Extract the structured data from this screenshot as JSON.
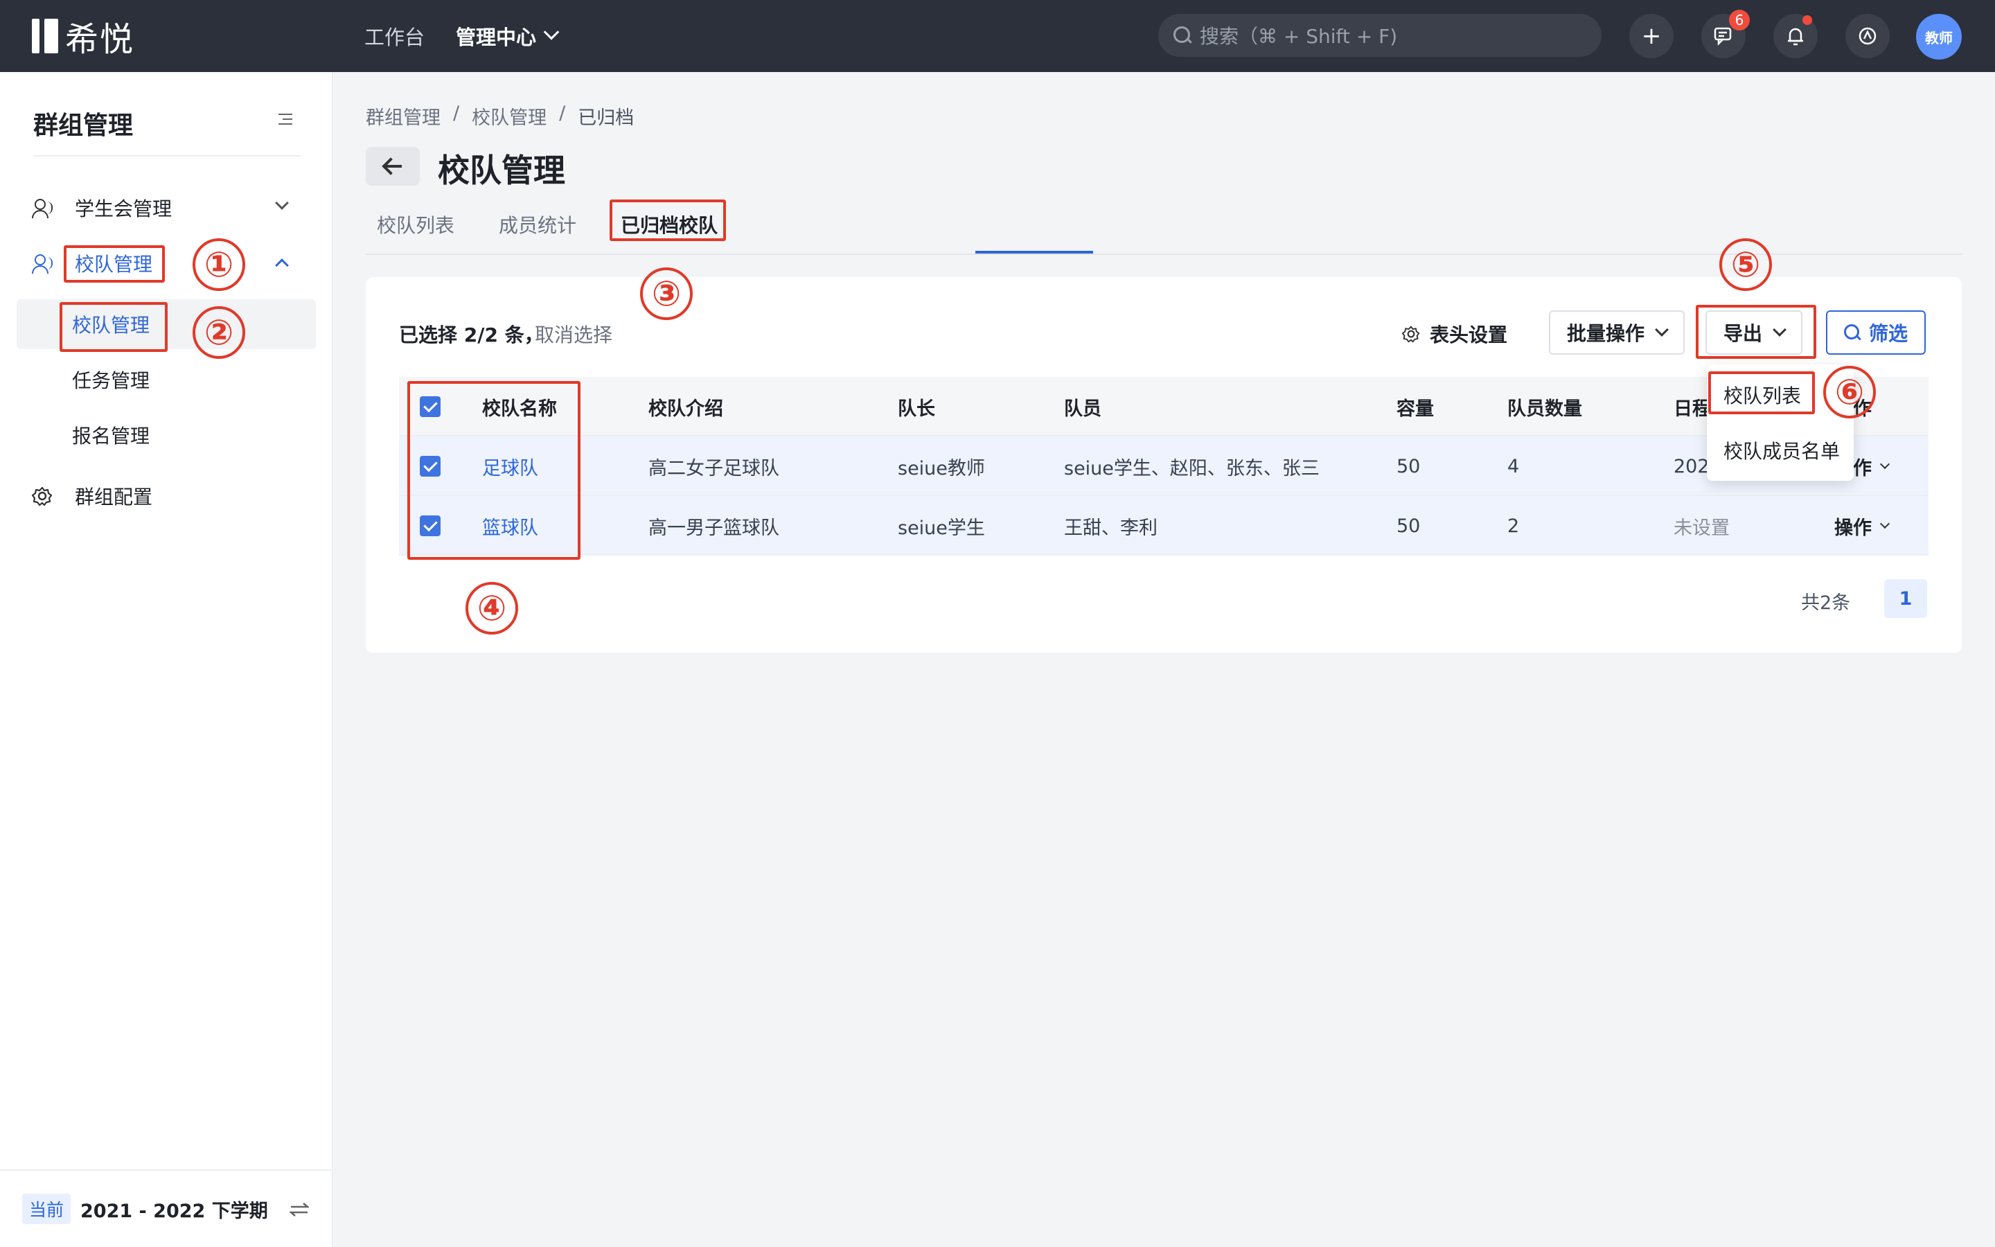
{
  "topbar": {
    "logo_text": "希悦",
    "nav": [
      {
        "label": "工作台"
      },
      {
        "label": "管理中心"
      }
    ],
    "search_placeholder": "搜索（⌘ + Shift + F)",
    "add_icon": "+",
    "message_badge": "6",
    "avatar_text": "教师"
  },
  "sidebar": {
    "title": "群组管理",
    "items": [
      {
        "label": "学生会管理"
      },
      {
        "label": "校队管理"
      }
    ],
    "sub_items": [
      {
        "label": "校队管理"
      },
      {
        "label": "任务管理"
      },
      {
        "label": "报名管理"
      }
    ],
    "config": {
      "label": "群组配置"
    },
    "footer": {
      "tag": "当前",
      "term": "2021 - 2022 下学期"
    }
  },
  "breadcrumb": [
    "群组管理",
    "/",
    "校队管理",
    "/",
    "已归档"
  ],
  "page_title": "校队管理",
  "tabs": [
    {
      "label": "校队列表"
    },
    {
      "label": "成员统计"
    },
    {
      "label": "已归档校队"
    }
  ],
  "toolbar": {
    "selection_text": "已选择 2/2 条，",
    "cancel_selection": "取消选择",
    "header_settings": "表头设置",
    "batch_ops": "批量操作",
    "export": "导出",
    "filter": "筛选"
  },
  "table": {
    "columns": [
      "校队名称",
      "校队介绍",
      "队长",
      "队员",
      "容量",
      "队员数量",
      "日程",
      "操作"
    ],
    "rows": [
      {
        "name": "足球队",
        "intro": "高二女子足球队",
        "captain": "seiue教师",
        "members": "seiue学生、赵阳、张东、张三",
        "capacity": "50",
        "count": "4",
        "schedule": "2021",
        "action": "操作"
      },
      {
        "name": "篮球队",
        "intro": "高一男子篮球队",
        "captain": "seiue学生",
        "members": "王甜、李利",
        "capacity": "50",
        "count": "2",
        "schedule": "未设置",
        "action": "操作"
      }
    ]
  },
  "pagination": {
    "total": "共2条",
    "current": "1"
  },
  "export_menu": [
    "校队列表",
    "校队成员名单"
  ],
  "annotations": [
    "①",
    "②",
    "③",
    "④",
    "⑤",
    "⑥"
  ],
  "colors": {
    "accent": "#2f66d8",
    "annotation": "#e03a2a",
    "topbar": "#2b303b"
  }
}
